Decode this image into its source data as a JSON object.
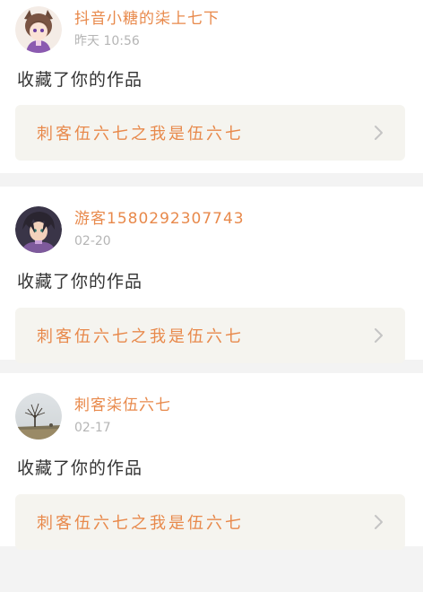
{
  "feed": {
    "items": [
      {
        "username": "抖音小糖的柒上七下",
        "time": "昨天 10:56",
        "action": "收藏了你的作品",
        "work_title": "刺客伍六七之我是伍六七",
        "avatar_icon": "anime-girl-avatar"
      },
      {
        "username": "游客1580292307743",
        "time": "02-20",
        "action": "收藏了你的作品",
        "work_title": "刺客伍六七之我是伍六七",
        "avatar_icon": "anime-boy-avatar"
      },
      {
        "username": "刺客柒伍六七",
        "time": "02-17",
        "action": "收藏了你的作品",
        "work_title": "刺客伍六七之我是伍六七",
        "avatar_icon": "landscape-tree-avatar"
      }
    ]
  },
  "colors": {
    "accent": "#e8894b",
    "muted": "#b5b5b5",
    "text": "#333333",
    "card_bg": "#f5f4ef"
  }
}
